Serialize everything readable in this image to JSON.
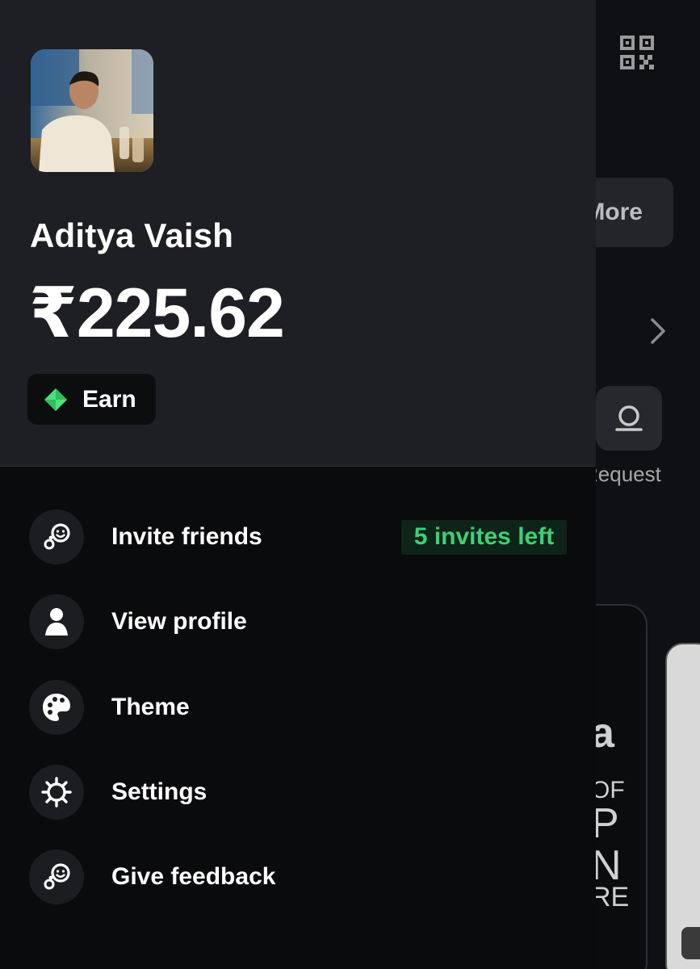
{
  "background": {
    "more_label": "More",
    "request_label": "Request",
    "promo_lines": [
      "a",
      "OF",
      "P",
      "N",
      "RE"
    ]
  },
  "drawer": {
    "user_name": "Aditya Vaish",
    "balance": "₹225.62",
    "earn_label": "Earn",
    "menu": [
      {
        "label": "Invite friends",
        "icon": "invite-icon",
        "badge": "5 invites left"
      },
      {
        "label": "View profile",
        "icon": "person-icon"
      },
      {
        "label": "Theme",
        "icon": "palette-icon"
      },
      {
        "label": "Settings",
        "icon": "gear-icon"
      },
      {
        "label": "Give feedback",
        "icon": "feedback-icon"
      }
    ]
  },
  "colors": {
    "drawer_header": "#1e1f24",
    "drawer_body": "#0a0b0d",
    "accent_green": "#3fcf78",
    "badge_bg": "#0e2418"
  }
}
